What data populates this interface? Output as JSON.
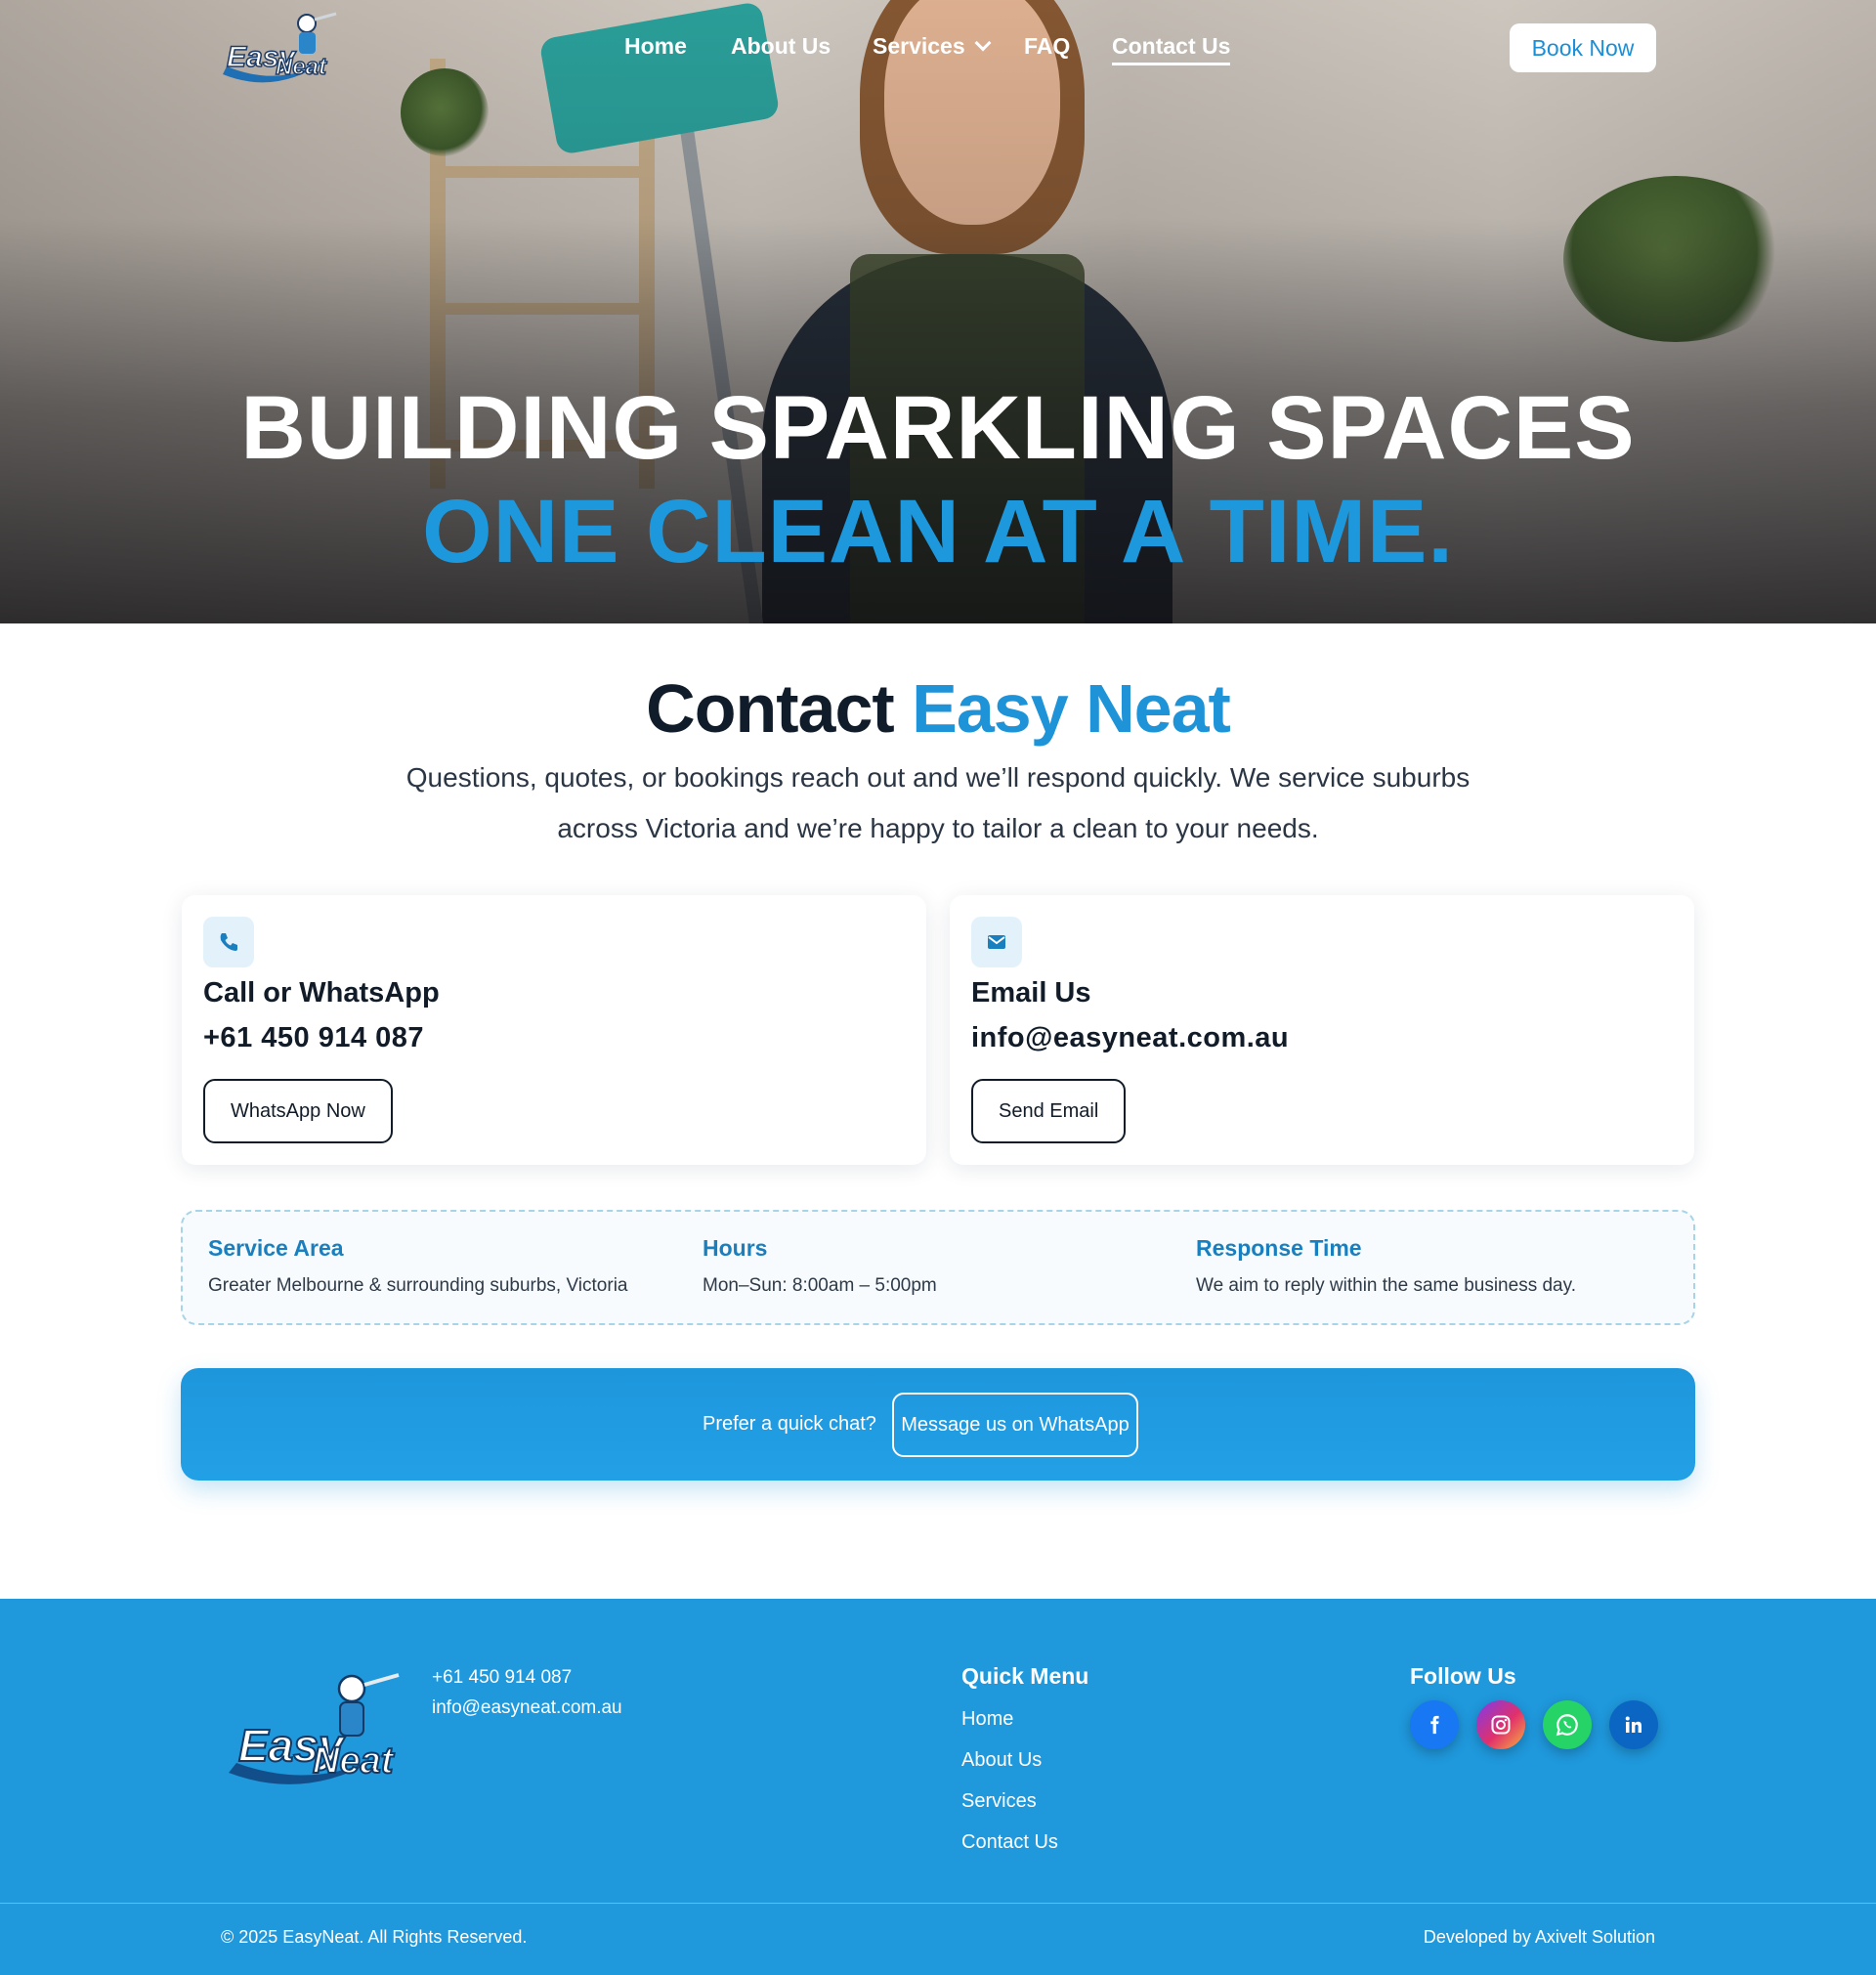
{
  "brand": {
    "logo_text_1": "Easy",
    "logo_text_2": "Neat"
  },
  "nav": {
    "items": [
      "Home",
      "About Us",
      "Services",
      "FAQ",
      "Contact Us"
    ],
    "active": "Contact Us",
    "book_label": "Book Now"
  },
  "hero": {
    "line1": "BUILDING SPARKLING SPACES",
    "line2": "ONE CLEAN AT A TIME."
  },
  "contact": {
    "title_dark": "Contact",
    "title_blue": "Easy Neat",
    "description": "Questions, quotes, or bookings reach out and we’ll respond quickly. We service suburbs across Victoria and we’re happy to tailor a clean to your needs."
  },
  "cards": {
    "phone": {
      "icon": "phone-icon",
      "title": "Call or WhatsApp",
      "value": "+61 450 914 087",
      "button": "WhatsApp Now"
    },
    "email": {
      "icon": "mail-icon",
      "title": "Email Us",
      "value": "info@easyneat.com.au",
      "button": "Send Email"
    }
  },
  "info": {
    "service_area": {
      "label": "Service Area",
      "text": "Greater Melbourne & surrounding suburbs, Victoria"
    },
    "hours": {
      "label": "Hours",
      "text": "Mon–Sun: 8:00am – 5:00pm"
    },
    "response": {
      "label": "Response Time",
      "text": "We aim to reply within the same business day."
    }
  },
  "cta": {
    "question": "Prefer a quick chat?",
    "button": "Message us on WhatsApp"
  },
  "footer": {
    "phone": "+61 450 914 087",
    "email": "info@easyneat.com.au",
    "quick_menu_title": "Quick Menu",
    "quick_menu": [
      "Home",
      "About Us",
      "Services",
      "Contact Us"
    ],
    "follow_title": "Follow Us",
    "social": [
      "facebook-icon",
      "instagram-icon",
      "whatsapp-icon",
      "linkedin-icon"
    ],
    "copyright": "© 2025 EasyNeat. All Rights Reserved.",
    "developer": "Developed by Axivelt Solution"
  },
  "colors": {
    "accent": "#1e96dc",
    "dark": "#111c28",
    "footer_bg": "#1f98dc"
  }
}
